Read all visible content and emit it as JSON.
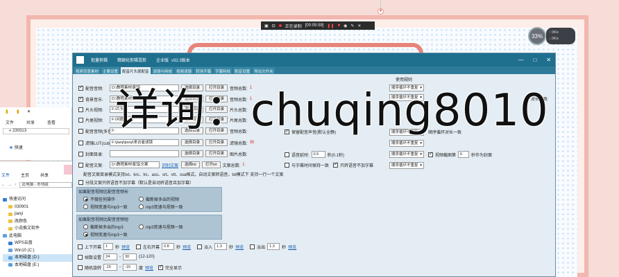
{
  "recorder": {
    "status": "正在录制",
    "time": "[00:05:59]"
  },
  "bubble": {
    "percent": "33%",
    "up": "0K/s",
    "down": "0K/s"
  },
  "explorer": {
    "tabs": [
      "文件",
      "共享",
      "查看"
    ],
    "path_top": "230313",
    "star_label": "快速",
    "menu": [
      "文件",
      "主页",
      "共享"
    ],
    "address": "此电脑  ›  本地磁",
    "tree": [
      {
        "label": "快速访问",
        "icon": "blue",
        "indent": false
      },
      {
        "label": "030901",
        "icon": "folder",
        "indent": true
      },
      {
        "label": "jianji",
        "icon": "folder",
        "indent": true
      },
      {
        "label": "改颜色",
        "icon": "folder",
        "indent": true
      },
      {
        "label": "小说推文软件",
        "icon": "folder",
        "indent": true
      },
      {
        "label": "此电脑",
        "icon": "pc",
        "indent": false
      },
      {
        "label": "WPS云盘",
        "icon": "blue",
        "indent": true
      },
      {
        "label": "Win10 (C:)",
        "icon": "pc",
        "indent": true
      },
      {
        "label": "本地磁盘 (D:)",
        "icon": "pc",
        "indent": true,
        "selected": true
      },
      {
        "label": "本地磁盘 (E:)",
        "icon": "pc",
        "indent": true
      }
    ]
  },
  "window": {
    "title_parts": [
      "批量剪辑",
      "精细化剪辑混剪",
      "企业版",
      "v32.3版本"
    ],
    "controls": [
      "—",
      "□",
      "✕"
    ],
    "tabs": [
      {
        "label": "视频背景素材",
        "active": false
      },
      {
        "label": "主要设置",
        "active": false
      },
      {
        "label": "配音片头尾配音",
        "active": true
      },
      {
        "label": "滤镜与特效",
        "active": false
      },
      {
        "label": "视频滤镜",
        "active": false
      },
      {
        "label": "转场字幕",
        "active": false
      },
      {
        "label": "字幕特效",
        "active": false
      },
      {
        "label": "配音设置",
        "active": false
      },
      {
        "label": "导出文件夹",
        "active": false
      }
    ],
    "rows": [
      {
        "label": "配音音频:",
        "checked": true,
        "path": "D:\\教程素材\\配音",
        "btn1": "选择目录",
        "btn2": "打开目录",
        "count_label": "音频总数:",
        "count": "1"
      },
      {
        "label": "背景音乐:",
        "checked": true,
        "path": "D:\\教程素材\\音乐",
        "btn1": "选择目录",
        "btn2": "打开目录",
        "count_label": "音频总数:",
        "count": "1"
      },
      {
        "label": "片头视频:",
        "checked": false,
        "path": "F:\\片头",
        "btn1": "选择目录",
        "btn2": "打开目录",
        "count_label": "片头总数:",
        "count": ""
      },
      {
        "label": "片尾视频:",
        "checked": false,
        "path": "F:\\问题",
        "btn1": "选择目录",
        "btn2": "打开目录",
        "count_label": "片尾总数:",
        "count": ""
      },
      {
        "label": "配音音频(多音):",
        "checked": false,
        "path": "F:",
        "btn1": "选择目录",
        "btn2": "打开目录",
        "count_label": "音频总数:",
        "count": ""
      },
      {
        "label": "滤镜LUT(cube):",
        "checked": false,
        "path": "F:\\jianji\\jianji\\来访者滤镜",
        "btn1": "选择目录",
        "btn2": "打开目录",
        "count_label": "滤镜总数:",
        "count": "30"
      },
      {
        "label": "封面目录:",
        "checked": false,
        "path": "",
        "btn1": "选择目录",
        "btn2": "打开目录",
        "count_label": "图片总数:",
        "count": ""
      },
      {
        "label": "配音文案:",
        "checked": false,
        "path": "D:\\教程素材\\配音文案",
        "btn1": "选择txt",
        "btn2": "打开txt",
        "count_label": "文案总数:",
        "count": "1",
        "link": "识别文案"
      }
    ],
    "hint": "配音文案目录模式支持txt、krc、lrc、ass、srt、vtt、ssa格式。自动文案转语音，txt模式下 支持一行一个文案",
    "split_option": "分段文案只转语音不加字幕（默认是自动转语音且加字幕）",
    "right": {
      "rule_title": "使用规则",
      "rule1": "顺序循环不重复",
      "rule2": "顺序循环不重复",
      "rule3": "顺序循环不重复",
      "rule4": "顺序循环不重复",
      "rule5": "顺序循环不重复",
      "rule6": "顺序循环不重复",
      "tail_text": "对长一致",
      "keep_label": "保留配音声音(默认全静)",
      "delay_label": "语音延时:",
      "delay_value": "0.5",
      "delay_unit": "秒(0.1秒)",
      "same_time_label": "与字幕时间保持一致",
      "only_voice_label": "只转语音不加字幕",
      "mirror_label": "视频截图第",
      "mirror_value": "6",
      "mirror_suffix": "秒作为封面",
      "bg_label": "顺序循环对长一致"
    },
    "group1": {
      "title": "如果配音视频比配音音频长",
      "options": [
        "不做任何操作",
        "截断掉多出的视频",
        "视频变速与mp3一致",
        "mp3变速与视频一致"
      ],
      "selected": 0
    },
    "group2": {
      "title": "如果配音视频比配音音频短",
      "options": [
        "截断掉多出的mp3",
        "mp3变速与视频一致",
        "视频变速与mp3一致"
      ],
      "selected": 2
    },
    "bottom": [
      {
        "label": "上下开幕",
        "value": "1",
        "unit": "秒",
        "link": "预览",
        "label2": "左右开幕",
        "value2": "0.8",
        "unit2": "秒",
        "link2": "预览",
        "label3": "淡入",
        "value3": "1.3",
        "unit3": "秒",
        "link3": "预览",
        "label4": "淡出",
        "value4": "1.3",
        "unit4": "秒",
        "link4": "预览"
      },
      {
        "label": "帧数设置",
        "value": "24",
        "value2": "30",
        "range": "(12-120)"
      },
      {
        "label": "随机旋转",
        "value": "-15",
        "value2": "-15",
        "unit": "度",
        "link": "预览",
        "label2": "完全显示"
      }
    ]
  },
  "watermark": "详询：chuqing8010"
}
